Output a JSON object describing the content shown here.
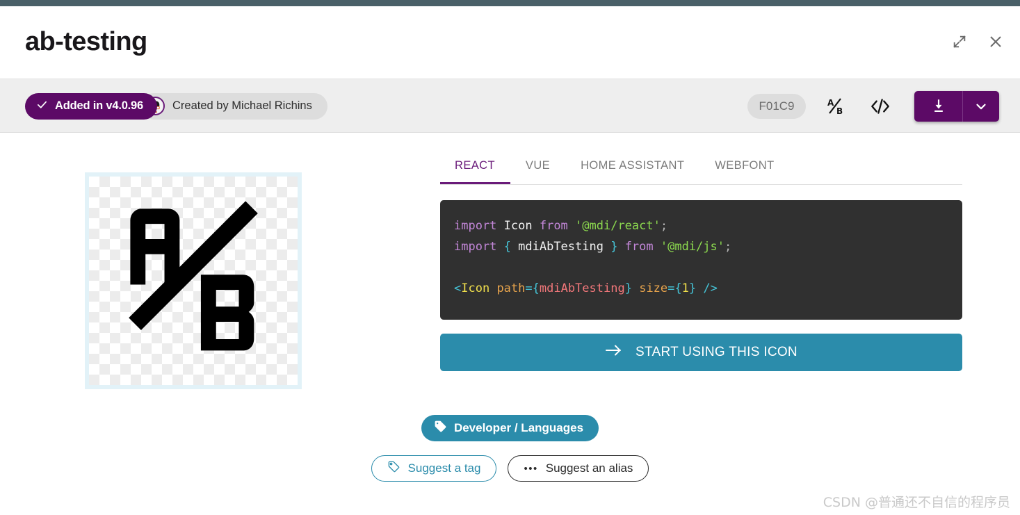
{
  "window": {
    "title": "ab-testing",
    "expand_icon": "expand-icon",
    "close_icon": "close-icon"
  },
  "toolbar": {
    "version_badge": {
      "icon": "check-icon",
      "label": "Added in v4.0.96",
      "color": "#5c0a66"
    },
    "author_badge": {
      "icon": "avatar-icon",
      "label": "Created by Michael Richins",
      "color": "#dddddd"
    },
    "hex_code": "F01C9",
    "alias_icon": "ab-alias-icon",
    "code_icon": "code-brackets-icon",
    "download_icon": "download-icon",
    "download_caret_icon": "chevron-down-icon",
    "download_color": "#5c0a66"
  },
  "preview": {
    "icon_name": "ab-testing-icon",
    "background": "checkerboard"
  },
  "tabs": [
    {
      "label": "REACT",
      "active": true
    },
    {
      "label": "VUE",
      "active": false
    },
    {
      "label": "HOME ASSISTANT",
      "active": false
    },
    {
      "label": "WEBFONT",
      "active": false
    }
  ],
  "code": {
    "line1": {
      "kw1": "import",
      "id1": " Icon ",
      "kw2": "from",
      "str1": " '@mdi/react'",
      "punc1": ";"
    },
    "line2": {
      "kw1": "import",
      "brace_open": " { ",
      "id1": "mdiAbTesting",
      "brace_close": " } ",
      "kw2": "from",
      "str1": " '@mdi/js'",
      "punc1": ";"
    },
    "line4": {
      "angle_open": "<",
      "tag": "Icon",
      "attr1": " path",
      "eq1": "=",
      "brace_open": "{",
      "var1": "mdiAbTesting",
      "brace_close": "}",
      "attr2": " size",
      "eq2": "=",
      "brace_open2": "{",
      "num": "1",
      "brace_close2": "}",
      "angle_close": " />"
    }
  },
  "start_button": {
    "arrow_icon": "arrow-right-icon",
    "label": "START USING THIS ICON",
    "color": "#2b8cab"
  },
  "tags": {
    "primary": {
      "icon": "tag-filled-icon",
      "label": "Developer / Languages"
    },
    "suggest_tag": {
      "icon": "tag-outline-icon",
      "label": "Suggest a tag"
    },
    "suggest_alias": {
      "icon": "dots-icon",
      "label": "Suggest an alias"
    }
  },
  "watermark": "CSDN @普通还不自信的程序员"
}
